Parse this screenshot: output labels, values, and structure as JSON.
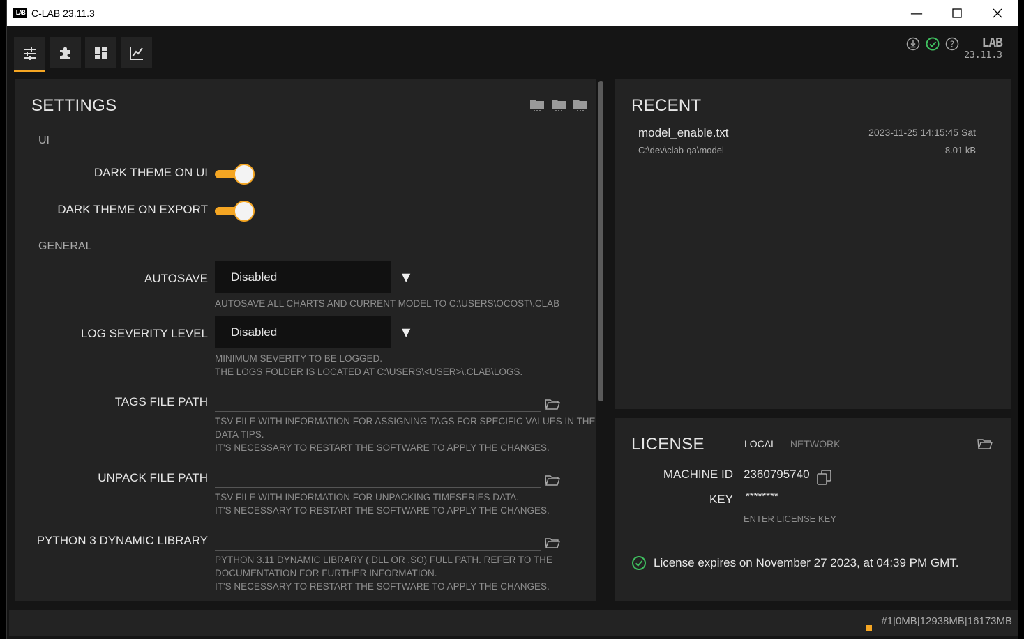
{
  "window": {
    "title": "C-LAB 23.11.3",
    "logo_text": "LAB"
  },
  "brand": {
    "mark": "LAB",
    "version": "23.11.3"
  },
  "toolbar": {
    "tabs": [
      "settings",
      "plugins",
      "layout",
      "charts"
    ]
  },
  "settings": {
    "title": "SETTINGS",
    "ui_section": "UI",
    "dark_theme_ui_label": "DARK THEME ON UI",
    "dark_theme_export_label": "DARK THEME ON EXPORT",
    "general_section": "GENERAL",
    "autosave_label": "AUTOSAVE",
    "autosave_value": "Disabled",
    "autosave_help": "AUTOSAVE ALL CHARTS AND CURRENT MODEL TO C:\\USERS\\OCOST\\.CLAB",
    "log_label": "LOG SEVERITY LEVEL",
    "log_value": "Disabled",
    "log_help_1": "MINIMUM SEVERITY TO BE LOGGED.",
    "log_help_2": "THE LOGS FOLDER IS LOCATED AT C:\\USERS\\<USER>\\.CLAB\\LOGS.",
    "tags_label": "TAGS FILE PATH",
    "tags_help_1": "TSV FILE WITH INFORMATION FOR ASSIGNING TAGS FOR SPECIFIC VALUES IN THE",
    "tags_help_2": "DATA TIPS.",
    "tags_help_3": "IT'S NECESSARY TO RESTART THE SOFTWARE TO APPLY THE CHANGES.",
    "unpack_label": "UNPACK FILE PATH",
    "unpack_help_1": "TSV FILE WITH INFORMATION FOR UNPACKING TIMESERIES DATA.",
    "unpack_help_2": "IT'S NECESSARY TO RESTART THE SOFTWARE TO APPLY THE CHANGES.",
    "python_label": "PYTHON 3 DYNAMIC LIBRARY",
    "python_help_1": "PYTHON 3.11 DYNAMIC LIBRARY (.DLL OR .SO) FULL PATH. REFER TO THE",
    "python_help_2": "DOCUMENTATION FOR FURTHER INFORMATION.",
    "python_help_3": "IT'S NECESSARY TO RESTART THE SOFTWARE TO APPLY THE CHANGES."
  },
  "recent": {
    "title": "RECENT",
    "items": [
      {
        "name": "model_enable.txt",
        "path": "C:\\dev\\clab-qa\\model",
        "date": "2023-11-25 14:15:45 Sat",
        "size": "8.01 kB"
      }
    ]
  },
  "license": {
    "title": "LICENSE",
    "tab_local": "LOCAL",
    "tab_network": "NETWORK",
    "machine_id_label": "MACHINE ID",
    "machine_id_value": "2360795740",
    "key_label": "KEY",
    "key_value": "********",
    "key_help": "ENTER LICENSE KEY",
    "status": "License expires on November 27 2023, at 04:39 PM GMT."
  },
  "statusbar": {
    "memory": "#1|0MB|12938MB|16173MB"
  },
  "colors": {
    "accent": "#f5a623",
    "success": "#3fbf5f"
  }
}
